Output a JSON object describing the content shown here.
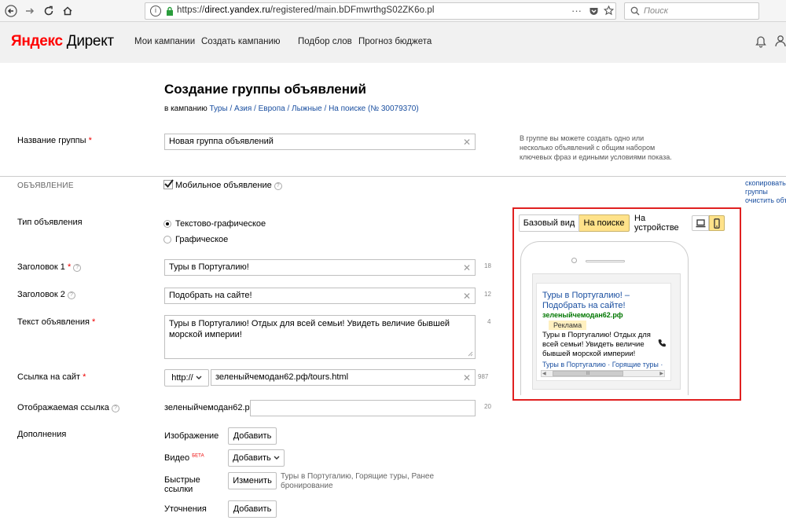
{
  "browser": {
    "url_protocol": "https://",
    "url_host": "direct.yandex.ru",
    "url_path": "/registered/main.bDFmwrthgS02ZK6o.pl",
    "search_placeholder": "Поиск"
  },
  "header": {
    "logo_brand": "Яндекс",
    "logo_product": "Директ",
    "nav": [
      "Мои кампании",
      "Создать кампанию",
      "Подбор слов",
      "Прогноз бюджета"
    ]
  },
  "page": {
    "title": "Создание группы объявлений",
    "subtitle_prefix": "в кампанию",
    "subtitle_link": "Туры / Азия / Европа / Лыжные / На поиске (№ 30079370)"
  },
  "group": {
    "label": "Название группы",
    "value": "Новая группа объявлений",
    "hint": "В группе вы можете создать одно или несколько объявлений с общим набором ключевых фраз и едиными условиями показа."
  },
  "section": {
    "label": "ОБЪЯВЛЕНИЕ",
    "mobile_checkbox": "Мобильное объявление",
    "copy_link_1": "скопировать с",
    "copy_link_2": "группы",
    "clear_link": "очистить объ"
  },
  "ad_type": {
    "label": "Тип объявления",
    "options": [
      "Текстово-графическое",
      "Графическое"
    ]
  },
  "title1": {
    "label": "Заголовок 1",
    "value": "Туры в Португалию!",
    "count": "18"
  },
  "title2": {
    "label": "Заголовок 2",
    "value": "Подобрать на сайте!",
    "count": "12"
  },
  "text": {
    "label": "Текст объявления",
    "value": "Туры в Португалию! Отдых для всей семьи! Увидеть величие бывшей морской империи!",
    "count": "4"
  },
  "link": {
    "label": "Ссылка на сайт",
    "protocol": "http://",
    "value": "зеленыйчемодан62.рф/tours.html",
    "count": "987"
  },
  "display_link": {
    "label": "Отображаемая ссылка",
    "prefix": "зеленыйчемодан62.рф/",
    "count": "20"
  },
  "extras": {
    "label": "Дополнения",
    "image_label": "Изображение",
    "image_button": "Добавить",
    "video_label": "Видео",
    "video_badge": "БЕТА",
    "video_button": "Добавить",
    "quicklinks_label_1": "Быстрые",
    "quicklinks_label_2": "ссылки",
    "quicklinks_button": "Изменить",
    "quicklinks_value": "Туры в Португалию, Горящие туры, Ранее бронирование",
    "clarifications_label": "Уточнения",
    "clarifications_button": "Добавить"
  },
  "preview": {
    "tab_base": "Базовый вид",
    "tab_search": "На поиске",
    "device_label": "На устройстве",
    "ad_title": "Туры в Португалию! – Подобрать на сайте!",
    "ad_domain": "зеленыйчемодан62.рф",
    "ad_badge": "Реклама",
    "ad_text": "Туры в Португалию! Отдых для всей семьи! Увидеть величие бывшей морской империи!",
    "ad_links": "Туры в Португалию · Горящие туры ·",
    "scroll_grip": "III"
  },
  "colors": {
    "link": "#1a4fa0",
    "required": "#e00000",
    "highlight_tab": "#ffe28a",
    "preview_border": "#e02020",
    "green_domain": "#007700"
  }
}
